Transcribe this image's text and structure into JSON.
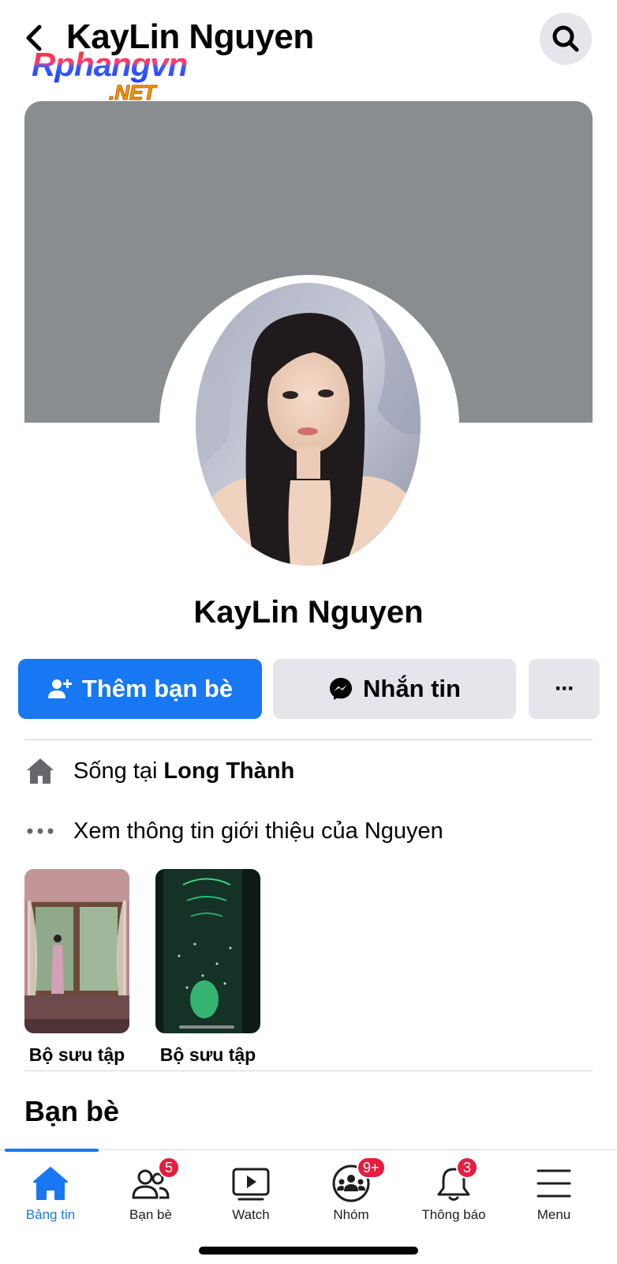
{
  "header": {
    "title": "KayLin Nguyen",
    "back_icon": "chevron-left-icon",
    "search_icon": "search-icon"
  },
  "watermark": {
    "main": "Rphangvn",
    "sub": ".NET"
  },
  "profile": {
    "name": "KayLin Nguyen"
  },
  "actions": {
    "add_friend_label": "Thêm bạn bè",
    "message_label": "Nhắn tin",
    "more_label": "···"
  },
  "intro": {
    "lives_prefix": "Sống tại",
    "lives_place": "Long Thành",
    "see_about": "Xem thông tin giới thiệu của Nguyen"
  },
  "collections": [
    {
      "label": "Bộ sưu tập"
    },
    {
      "label": "Bộ sưu tập"
    }
  ],
  "friends_section": {
    "title": "Bạn bè"
  },
  "tabbar": {
    "tabs": [
      {
        "label": "Bảng tin",
        "icon": "home-icon",
        "badge": ""
      },
      {
        "label": "Bạn bè",
        "icon": "friends-icon",
        "badge": "5"
      },
      {
        "label": "Watch",
        "icon": "watch-icon",
        "badge": ""
      },
      {
        "label": "Nhóm",
        "icon": "groups-icon",
        "badge": "9+"
      },
      {
        "label": "Thông báo",
        "icon": "bell-icon",
        "badge": "3"
      },
      {
        "label": "Menu",
        "icon": "menu-icon",
        "badge": ""
      }
    ]
  },
  "colors": {
    "accent": "#1877f2",
    "cover": "#8a8d8f",
    "button_gray": "#e4e6eb",
    "badge": "#e41e3f"
  }
}
